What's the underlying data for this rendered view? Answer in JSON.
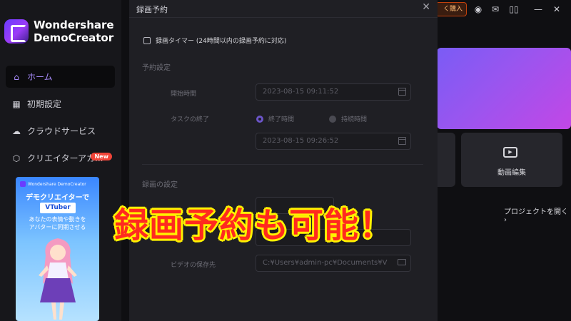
{
  "app": {
    "name_line1": "Wondershare",
    "name_line2": "DemoCreator"
  },
  "sidebar": {
    "items": [
      {
        "label": "ホーム",
        "icon": "home-icon",
        "active": true
      },
      {
        "label": "初期設定",
        "icon": "grid-icon"
      },
      {
        "label": "クラウドサービス",
        "icon": "cloud-icon"
      },
      {
        "label": "クリエイターアカ...",
        "icon": "creator-icon",
        "badge": "New"
      }
    ]
  },
  "promo": {
    "brand": "Wondershare DemoCreator",
    "title": "デモクリエイターで",
    "pill": "VTuber",
    "sub_line1": "あなたの表情や動きを",
    "sub_line2": "アバターに同期させる"
  },
  "topbar": {
    "buy_label": "く購入"
  },
  "home": {
    "edit_card_label": "動画編集",
    "open_project_label": "プロジェクトを開く ›"
  },
  "dialog": {
    "title": "録画予約",
    "timer_checkbox_label": "録画タイマー (24時間以内の録画予約に対応)",
    "schedule_section": "予約設定",
    "start_time_label": "開始時間",
    "start_time_value": "2023-08-15 09:11:52",
    "task_end_label": "タスクの終了",
    "end_time_option": "終了時間",
    "duration_option": "持続時間",
    "end_time_value": "2023-08-15 09:26:52",
    "recording_section": "録画の設定",
    "save_location_label": "ビデオの保存先",
    "save_location_value": "C:¥Users¥admin-pc¥Documents¥V"
  },
  "overlay": {
    "caption": "録画予約も可能！"
  },
  "colors": {
    "accent": "#a78bfa",
    "caption_fill": "#ff2a1f",
    "caption_outline": "#fff200",
    "badge": "#f04438"
  }
}
